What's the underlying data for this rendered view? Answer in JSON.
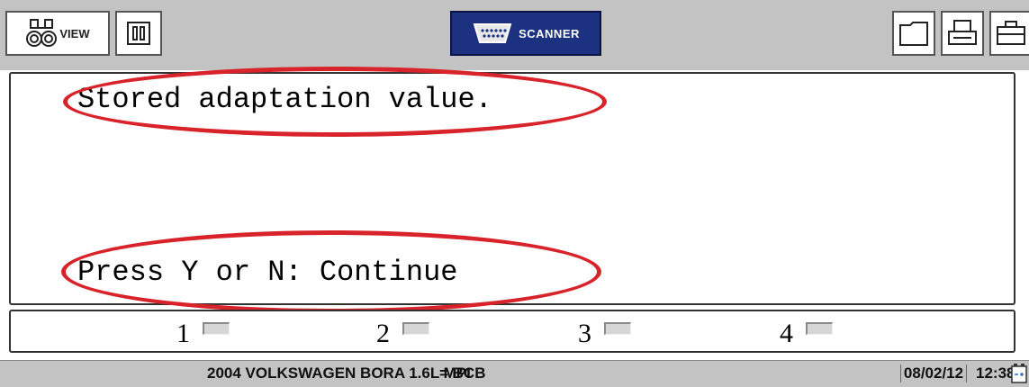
{
  "toolbar": {
    "view_label": "VIEW",
    "scanner_label": "SCANNER"
  },
  "main": {
    "line1": "Stored adaptation value.",
    "line2": "Press Y or N: Continue"
  },
  "function_keys": [
    {
      "label": "1"
    },
    {
      "label": "2"
    },
    {
      "label": "3"
    },
    {
      "label": "4"
    }
  ],
  "status": {
    "vehicle": "2004 VOLKSWAGEN BORA 1.6L MPI",
    "engine_code": "= BCB",
    "date": "08/02/12",
    "time": "12:38"
  },
  "colors": {
    "toolbar_bg": "#c3c3c3",
    "scanner_button_bg": "#1c3280",
    "annotation_red": "#d8232a"
  },
  "icons": [
    "binoculars-icon",
    "pause-icon",
    "obd-connector-icon",
    "folder-icon",
    "printer-icon",
    "toolbox-icon",
    "battery-icon"
  ]
}
